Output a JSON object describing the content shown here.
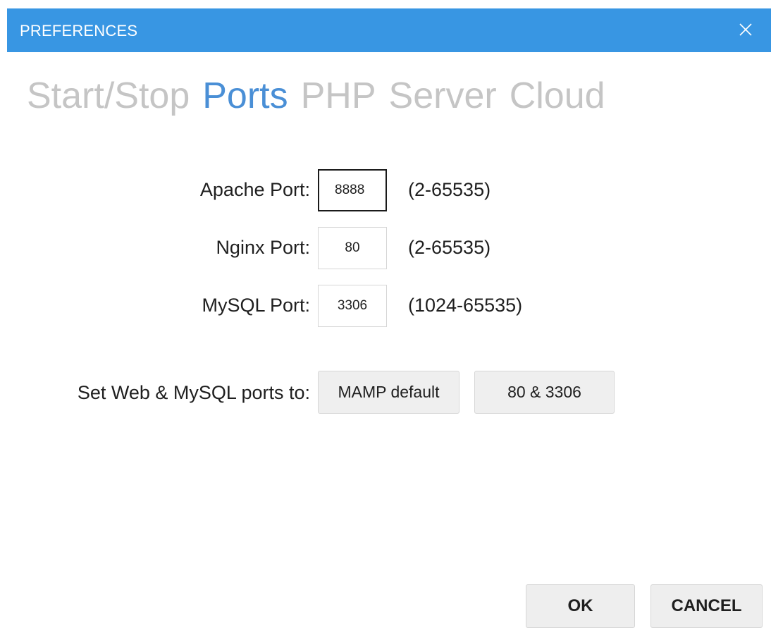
{
  "window": {
    "title": "PREFERENCES",
    "close_glyph": "✕"
  },
  "tabs": [
    {
      "label": "Start/Stop",
      "active": false
    },
    {
      "label": "Ports",
      "active": true
    },
    {
      "label": "PHP",
      "active": false
    },
    {
      "label": "Server",
      "active": false
    },
    {
      "label": "Cloud",
      "active": false
    }
  ],
  "ports": {
    "apache": {
      "label": "Apache Port:",
      "value": "8888",
      "range": "(2-65535)"
    },
    "nginx": {
      "label": "Nginx Port:",
      "value": "80",
      "range": "(2-65535)"
    },
    "mysql": {
      "label": "MySQL Port:",
      "value": "3306",
      "range": "(1024-65535)"
    }
  },
  "presets": {
    "label": "Set Web & MySQL ports to:",
    "mamp_default": "MAMP default",
    "standard": "80 & 3306"
  },
  "footer": {
    "ok": "OK",
    "cancel": "CANCEL"
  },
  "colors": {
    "titlebar": "#3896e3",
    "active_tab": "#4a8fd6",
    "inactive_tab": "#c5c5c5"
  }
}
